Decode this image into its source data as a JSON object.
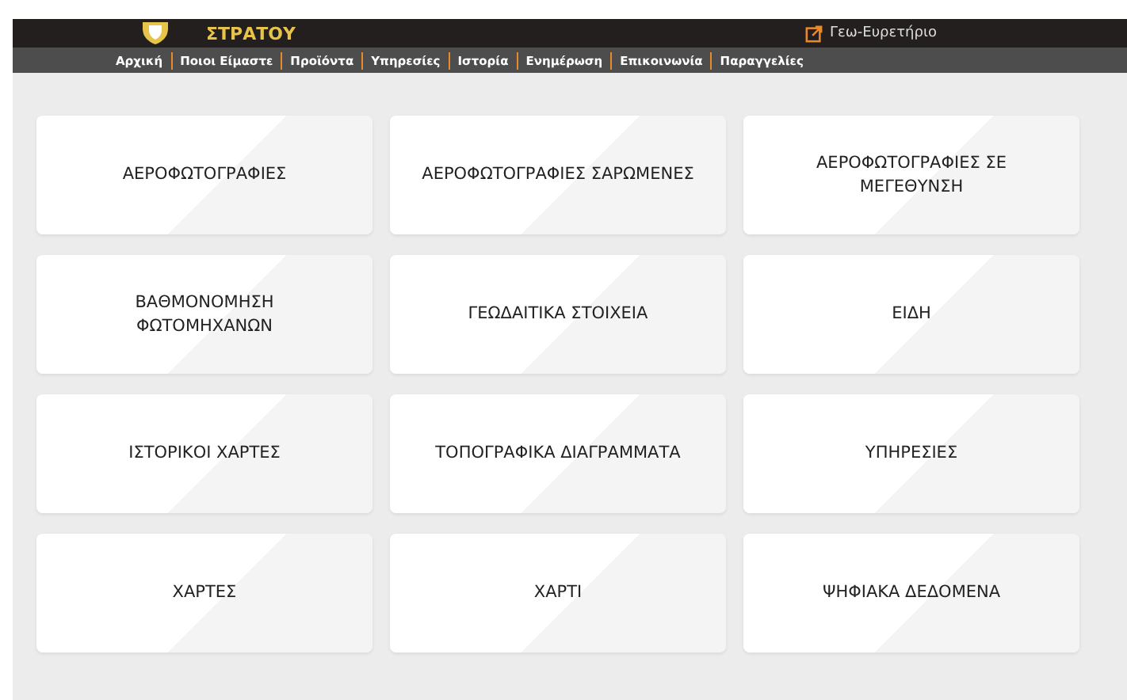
{
  "header": {
    "brand": "ΣΤΡΑΤΟΥ",
    "link": "Γεω-Ευρετήριο"
  },
  "nav": [
    "Αρχική",
    "Ποιοι Είμαστε",
    "Προϊόντα",
    "Υπηρεσίες",
    "Ιστορία",
    "Ενημέρωση",
    "Επικοινωνία",
    "Παραγγελίες"
  ],
  "categories": [
    "ΑΕΡΟΦΩΤΟΓΡΑΦΙΕΣ",
    "ΑΕΡΟΦΩΤΟΓΡΑΦΙΕΣ ΣΑΡΩΜΕΝΕΣ",
    "ΑΕΡΟΦΩΤΟΓΡΑΦΙΕΣ ΣΕ ΜΕΓΕΘΥΝΣΗ",
    "ΒΑΘΜΟΝΟΜΗΣΗ ΦΩΤΟΜΗΧΑΝΩΝ",
    "ΓΕΩΔΑΙΤΙΚΑ ΣΤΟΙΧΕΙΑ",
    "ΕΙΔΗ",
    "ΙΣΤΟΡΙΚΟΙ ΧΑΡΤΕΣ",
    "ΤΟΠΟΓΡΑΦΙΚΑ ΔΙΑΓΡΑΜΜΑΤΑ",
    "ΥΠΗΡΕΣΙΕΣ",
    "ΧΑΡΤΕΣ",
    "ΧΑΡΤΙ",
    "ΨΗΦΙΑΚΑ ΔΕΔΟΜΕΝΑ"
  ]
}
